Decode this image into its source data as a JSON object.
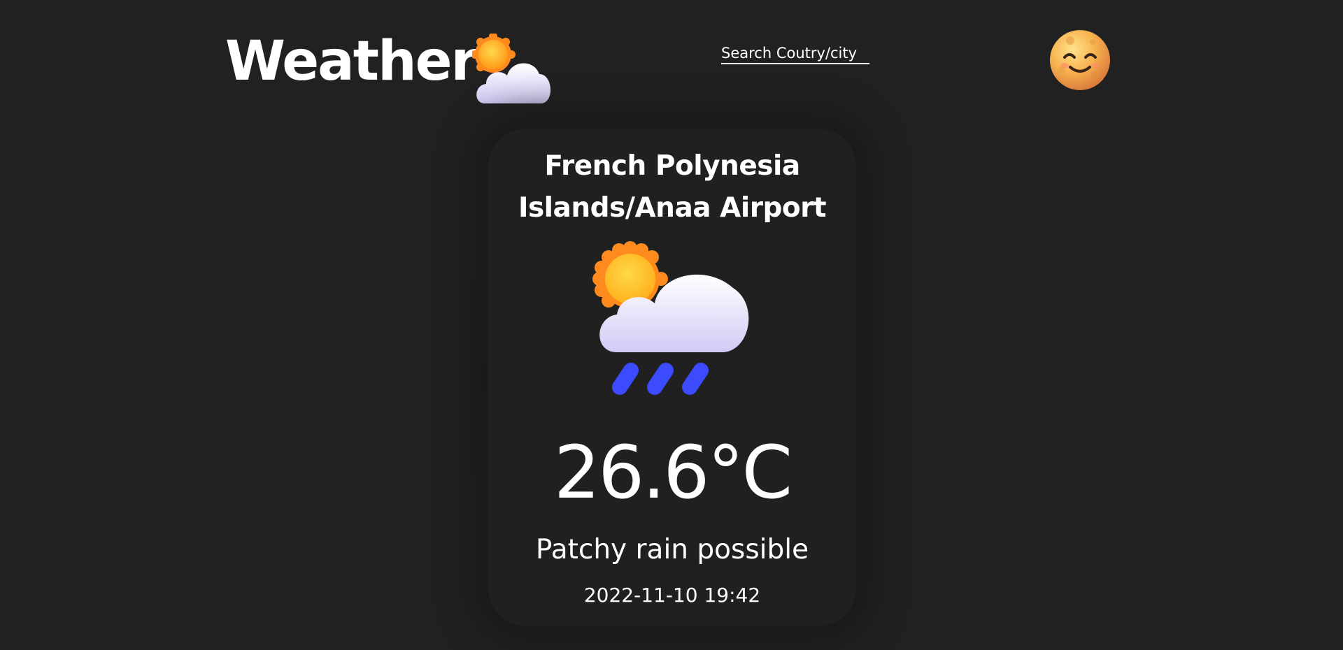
{
  "header": {
    "title": "Weather",
    "brand_icon": "sun-behind-cloud-icon",
    "search": {
      "placeholder": "Search Coutry/city",
      "value": ""
    },
    "avatar_icon": "smiling-moon-face-icon"
  },
  "card": {
    "location_line1": "French Polynesia",
    "location_line2": "Islands/Anaa Airport",
    "weather_icon": "sun-behind-rain-cloud-icon",
    "temperature": "26.6°C",
    "condition": "Patchy rain possible",
    "datetime": "2022-11-10 19:42"
  },
  "colors": {
    "background": "#212121",
    "card": "#202020",
    "text": "#ffffff",
    "rain": "#3d4bff",
    "sun": "#ffb300"
  }
}
